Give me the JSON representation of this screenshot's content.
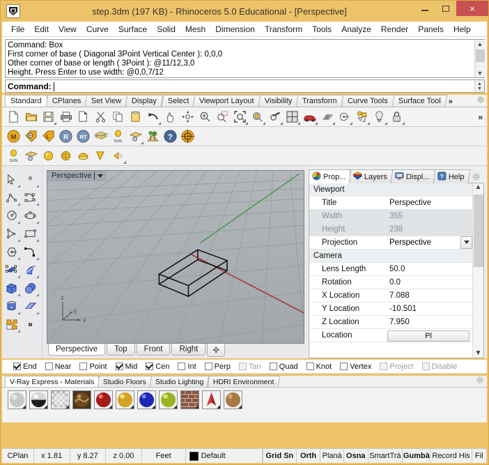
{
  "window": {
    "title": "step.3dm (197 KB) - Rhinoceros 5.0 Educational - [Perspective]",
    "logo_icon": "rhino-logo-icon",
    "minimize_label": "minimize-icon",
    "maximize_label": "maximize-icon",
    "close_label": "×"
  },
  "menubar": {
    "items": [
      "File",
      "Edit",
      "View",
      "Curve",
      "Surface",
      "Solid",
      "Mesh",
      "Dimension",
      "Transform",
      "Tools",
      "Analyze",
      "Render",
      "Panels",
      "Help"
    ]
  },
  "command": {
    "history": [
      "Command: Box",
      "First corner of base ( Diagonal  3Point  Vertical  Center ): 0,0,0",
      "Other corner of base or length ( 3Point ): @11/12,3,0",
      "Height. Press Enter to use width: @0,0,7/12"
    ],
    "prompt": "Command:",
    "input_value": ""
  },
  "toolbar_tabs": {
    "items": [
      "Standard",
      "CPlanes",
      "Set View",
      "Display",
      "Select",
      "Viewport Layout",
      "Visibility",
      "Transform",
      "Curve Tools",
      "Surface Tool"
    ],
    "active": "Standard",
    "overflow_label": "»",
    "gear_icon": "gear-icon"
  },
  "toolbar_standard": {
    "overflow_label": "»",
    "buttons": [
      {
        "name": "new-file-icon",
        "flyout": false
      },
      {
        "name": "open-file-icon",
        "flyout": false
      },
      {
        "name": "save-file-icon",
        "flyout": true
      },
      {
        "name": "print-icon",
        "flyout": false
      },
      {
        "name": "copy-to-clipboard-icon",
        "flyout": false
      },
      {
        "name": "cut-scissors-icon",
        "flyout": false
      },
      {
        "name": "copy-icon",
        "flyout": false
      },
      {
        "name": "paste-icon",
        "flyout": false
      },
      {
        "name": "undo-icon",
        "flyout": true
      },
      {
        "name": "pan-hand-icon",
        "flyout": false
      },
      {
        "name": "rotate-view-icon",
        "flyout": false
      },
      {
        "name": "zoom-in-out-icon",
        "flyout": false
      },
      {
        "name": "zoom-window-icon",
        "flyout": false
      },
      {
        "name": "zoom-extents-icon",
        "flyout": true
      },
      {
        "name": "zoom-selected-icon",
        "flyout": true
      },
      {
        "name": "undo-view-change-icon",
        "flyout": true
      },
      {
        "name": "viewport-layout-icon",
        "flyout": true
      },
      {
        "name": "render-car-icon",
        "flyout": true
      },
      {
        "name": "cplane-grid-icon",
        "flyout": true
      },
      {
        "name": "set-view-icon",
        "flyout": true
      },
      {
        "name": "layer-objects-icon",
        "flyout": true
      },
      {
        "name": "light-bulb-icon",
        "flyout": true
      },
      {
        "name": "lock-icon",
        "flyout": true
      }
    ]
  },
  "toolbar_render": {
    "buttons": [
      {
        "name": "materials-m-icon",
        "label": "M"
      },
      {
        "name": "material-tag-o-icon",
        "label": "O"
      },
      {
        "name": "material-tag-l-icon",
        "label": "L"
      },
      {
        "name": "render-r-icon",
        "label": "R"
      },
      {
        "name": "render-rt-icon",
        "label": "RT"
      },
      {
        "name": "mesh-layers-icon",
        "label": ""
      },
      {
        "name": "sun-icon",
        "label": "SUN"
      },
      {
        "name": "render-preview-icon",
        "label": ""
      },
      {
        "name": "environment-plants-icon",
        "label": ""
      },
      {
        "name": "help-question-icon",
        "label": "?"
      },
      {
        "name": "target-focus-icon",
        "label": ""
      }
    ]
  },
  "toolbar_lights": {
    "buttons": [
      {
        "name": "sun-light-icon",
        "label": "SUN"
      },
      {
        "name": "ground-plane-icon",
        "label": ""
      },
      {
        "name": "point-light-icon",
        "label": ""
      },
      {
        "name": "sphere-light-icon",
        "label": ""
      },
      {
        "name": "dome-light-icon",
        "label": ""
      },
      {
        "name": "spot-light-icon",
        "label": ""
      },
      {
        "name": "directional-light-icon",
        "label": ""
      }
    ]
  },
  "left_toolbar": {
    "buttons": [
      {
        "name": "select-arrow-icon"
      },
      {
        "name": "point-object-icon"
      },
      {
        "name": "polyline-icon"
      },
      {
        "name": "control-point-curve-icon"
      },
      {
        "name": "circle-icon"
      },
      {
        "name": "ellipse-icon"
      },
      {
        "name": "arc-icon"
      },
      {
        "name": "rectangle-icon"
      },
      {
        "name": "polygon-icon"
      },
      {
        "name": "curve-blend-icon"
      },
      {
        "name": "surface-from-points-icon"
      },
      {
        "name": "surface-loft-icon"
      },
      {
        "name": "box-solid-icon"
      },
      {
        "name": "sphere-solid-icon"
      },
      {
        "name": "cylinder-solid-icon"
      },
      {
        "name": "mesh-plane-icon"
      },
      {
        "name": "boolean-puzzle-icon"
      }
    ],
    "overflow_label": "»"
  },
  "viewport": {
    "label": "Perspective",
    "dropdown_icon": "chevron-down-icon",
    "background_color": "#a9aeb2",
    "grid_color": "#8d9296",
    "x_axis_color": "#a03030",
    "y_axis_color": "#3f8f3f",
    "axes": {
      "x": "x",
      "y": "y",
      "z": "z"
    },
    "object": "wireframe-box"
  },
  "viewport_tabs": {
    "items": [
      "Perspective",
      "Top",
      "Front",
      "Right"
    ],
    "active": "Perspective",
    "add_label": "✜"
  },
  "panel_tabs": {
    "items": [
      {
        "label": "Prop...",
        "icon": "properties-color-wheel-icon"
      },
      {
        "label": "Layers",
        "icon": "layers-icon"
      },
      {
        "label": "Displ...",
        "icon": "display-monitor-icon"
      },
      {
        "label": "Help",
        "icon": "help-icon"
      }
    ],
    "active": "Prop...",
    "gear_icon": "gear-icon"
  },
  "properties": {
    "groups": [
      {
        "title": "Viewport",
        "rows": [
          {
            "name": "Title",
            "value": "Perspective",
            "type": "text",
            "dim": false
          },
          {
            "name": "Width",
            "value": "355",
            "type": "text",
            "dim": true
          },
          {
            "name": "Height",
            "value": "238",
            "type": "text",
            "dim": true
          },
          {
            "name": "Projection",
            "value": "Perspective",
            "type": "combo",
            "dim": false
          }
        ]
      },
      {
        "title": "Camera",
        "rows": [
          {
            "name": "Lens Length",
            "value": "50.0",
            "type": "text",
            "dim": false
          },
          {
            "name": "Rotation",
            "value": "0.0",
            "type": "text",
            "dim": false
          },
          {
            "name": "X Location",
            "value": "7.088",
            "type": "text",
            "dim": false
          },
          {
            "name": "Y Location",
            "value": "-10.501",
            "type": "text",
            "dim": false
          },
          {
            "name": "Z Location",
            "value": "7.950",
            "type": "text",
            "dim": false
          },
          {
            "name": "Location",
            "value": "Pl",
            "type": "button",
            "dim": false
          }
        ]
      }
    ]
  },
  "osnap": {
    "items": [
      {
        "label": "End",
        "checked": true,
        "disabled": false
      },
      {
        "label": "Near",
        "checked": false,
        "disabled": false
      },
      {
        "label": "Point",
        "checked": false,
        "disabled": false
      },
      {
        "label": "Mid",
        "checked": true,
        "disabled": false
      },
      {
        "label": "Cen",
        "checked": true,
        "disabled": false
      },
      {
        "label": "Int",
        "checked": false,
        "disabled": false
      },
      {
        "label": "Perp",
        "checked": false,
        "disabled": false
      },
      {
        "label": "Tan",
        "checked": false,
        "disabled": true
      },
      {
        "label": "Quad",
        "checked": false,
        "disabled": false
      },
      {
        "label": "Knot",
        "checked": false,
        "disabled": false
      },
      {
        "label": "Vertex",
        "checked": false,
        "disabled": false
      },
      {
        "label": "Project",
        "checked": false,
        "disabled": true
      },
      {
        "label": "Disable",
        "checked": false,
        "disabled": true
      }
    ]
  },
  "materials": {
    "tabs": [
      "V-Ray Express - Materials",
      "Studio Floors",
      "Studio Lighting",
      "HDRI Environment"
    ],
    "active": "V-Ray Express - Materials",
    "gear_icon": "gear-icon",
    "swatches": [
      {
        "name": "material-gray-plastic",
        "color": "#c9c9c9"
      },
      {
        "name": "material-chrome",
        "color": "#2a2a2a"
      },
      {
        "name": "material-checker-transparent",
        "color": "#d8d8d8"
      },
      {
        "name": "material-bronze-texture",
        "color": "#6b4a22"
      },
      {
        "name": "material-red-glossy",
        "color": "#a61a1a"
      },
      {
        "name": "material-gold",
        "color": "#d3a322"
      },
      {
        "name": "material-blue-glossy",
        "color": "#1a28b4"
      },
      {
        "name": "material-yellow-green",
        "color": "#9fb321"
      },
      {
        "name": "material-brick",
        "color": "#8a5240"
      },
      {
        "name": "material-red-cloth",
        "color": "#b02020"
      },
      {
        "name": "material-tan-wood",
        "color": "#a97a46"
      }
    ]
  },
  "statusbar": {
    "cplane_label": "CPlan",
    "x_label": "x 1.81",
    "y_label": "y 8.27",
    "z_label": "z 0.00",
    "units": "Feet",
    "layer": "Default",
    "layer_color": "#000000",
    "toggles": [
      {
        "label": "Grid Sn",
        "bold": true
      },
      {
        "label": "Orth",
        "bold": true
      },
      {
        "label": "Planà",
        "bold": false
      },
      {
        "label": "Osna",
        "bold": true
      },
      {
        "label": "SmartTrà",
        "bold": false
      },
      {
        "label": "Gumbà",
        "bold": true
      },
      {
        "label": "Record His",
        "bold": false
      },
      {
        "label": "Fil",
        "bold": false
      }
    ]
  }
}
